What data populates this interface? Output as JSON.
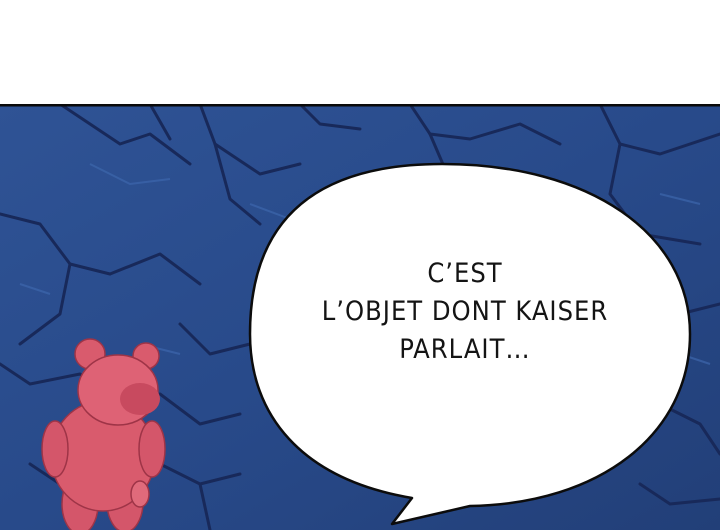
{
  "speech_bubble": {
    "lines": [
      "C’EST",
      "L’OBJET DONT KAISER",
      "PARLAIT…"
    ]
  },
  "colors": {
    "panel_border": "#0a0a0a",
    "rock_base": "#2c4e8f",
    "rock_dark": "#1b3264",
    "bear": "#d95b6d",
    "bubble": "#ffffff"
  }
}
